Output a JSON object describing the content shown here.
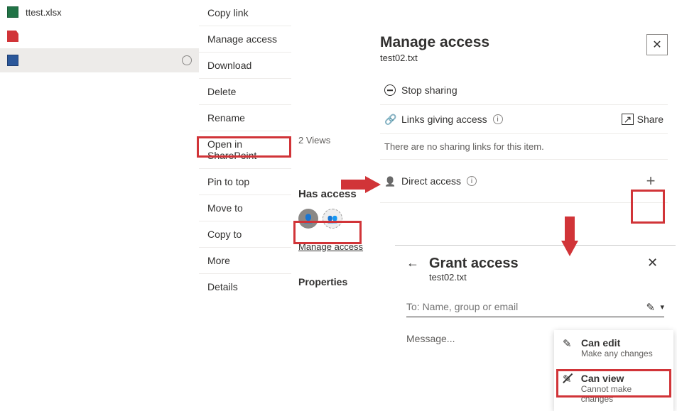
{
  "files": [
    {
      "name": "ttest.xlsx",
      "icon": "xls"
    },
    {
      "name": "",
      "icon": "pdf"
    },
    {
      "name": "",
      "icon": "doc"
    }
  ],
  "context_menu": [
    "Copy link",
    "Manage access",
    "Download",
    "Delete",
    "Rename",
    "Open in SharePoint",
    "Pin to top",
    "Move to",
    "Copy to",
    "More",
    "Details"
  ],
  "mid": {
    "views": "2 Views",
    "has_access": "Has access",
    "manage_access": "Manage access",
    "properties": "Properties"
  },
  "panel": {
    "title": "Manage access",
    "file": "test02.txt",
    "stop_sharing": "Stop sharing",
    "links_giving_access": "Links giving access",
    "share": "Share",
    "no_links": "There are no sharing links for this item.",
    "direct_access": "Direct access"
  },
  "grant": {
    "title": "Grant access",
    "file": "test02.txt",
    "placeholder": "To: Name, group or email",
    "message": "Message..."
  },
  "perm": {
    "edit_t": "Can edit",
    "edit_d": "Make any changes",
    "view_t": "Can view",
    "view_d": "Cannot make changes"
  }
}
